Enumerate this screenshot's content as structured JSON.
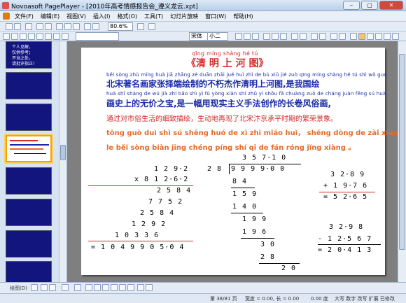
{
  "window": {
    "title": "Novoasoft PagePlayer - [2010年高考情感报告会_遵义龙云.xpt]",
    "minimize": "–",
    "maximize": "▢",
    "close": "✕"
  },
  "menu": [
    "文件(F)",
    "编辑(E)",
    "视图(V)",
    "插入(I)",
    "格式(O)",
    "工具(T)",
    "幻灯片放映",
    "窗口(W)",
    "帮助(H)"
  ],
  "toolbar": {
    "zoom": "80.6%",
    "font": "宋体",
    "size": "小二"
  },
  "sidebar": {
    "slide_numbers": [
      "",
      "",
      "",
      "",
      "",
      "",
      "",
      ""
    ],
    "first_thumb_text": "个人见解，\n仅供参考；\n不当之处，\n请批评指正！"
  },
  "slide": {
    "title_pinyin": "qīng míng shàng hé tú",
    "title": "《清 明 上 河 图》",
    "line1_pinyin": "běi sòng zhù míng huà jiā zhāng zé duān zhāi jué huì zhì de bù xiǔ jié zuò qīng míng shàng hé tú shì wǒ guó huì",
    "line1": "北宋著名画家张择端绘制的不朽杰作清明上河图,是我国绘",
    "line2_pinyin": "huà shǐ shàng de wú jià zhī bǎo shì yì fú yòng xiàn shí zhǔ yì shǒu fǎ chuàng zuò de cháng juàn fēng sú huà",
    "line2": "画史上的无价之宝,是一幅用现实主义手法创作的长卷风俗画,",
    "line3": "通过对市俗生活的细致描绘，生动地再现了北宋汴京承平时期的繁荣景象。",
    "line4": "tōng guò duì shì sú shēng huó de xì zhì miáo huì， shēng dòng de zài xiàn",
    "line5": "le běi sòng biàn jīng chéng píng shí qī de fán róng jǐng xiàng 。",
    "mult": {
      "a": "1 2 9·2",
      "b": "x 8 1 2·6·2",
      "p1": "2 5 8 4",
      "p2": "7 7 5 2",
      "p3": "2 5 8 4",
      "p4": "1 2 9 2",
      "p5": "1 0 3 3 6",
      "result": "= 1 0 4 9 9 0 5·0 4"
    },
    "div": {
      "quotient": "3 5 7·1 0",
      "divisor": "2 8",
      "dividend": "9 9 9 9·0 0",
      "r1": "8 4",
      "r2": "1 5 9",
      "r3": "1 4 0",
      "r4": "1 9 9",
      "r5": "1 9 6",
      "r6": "3 0",
      "r7": "2 8",
      "r8": "2 0"
    },
    "add": {
      "a": "3 2·8 9",
      "b": "+ 1 9·7 6",
      "r": "= 5 2·6 5"
    },
    "sub": {
      "a": "3 2·9 8",
      "b": "- 1 2·5 6 7",
      "r": "= 2 0·4 1 3"
    }
  },
  "drawbar": {
    "label": "绘图(D)"
  },
  "status": {
    "slide": "第 38/81 页",
    "pos": "宽度 = 0.00, 长 = 0.00",
    "extra": "0.00 度",
    "mode": "大写 数字 改写 扩展 已修改"
  }
}
